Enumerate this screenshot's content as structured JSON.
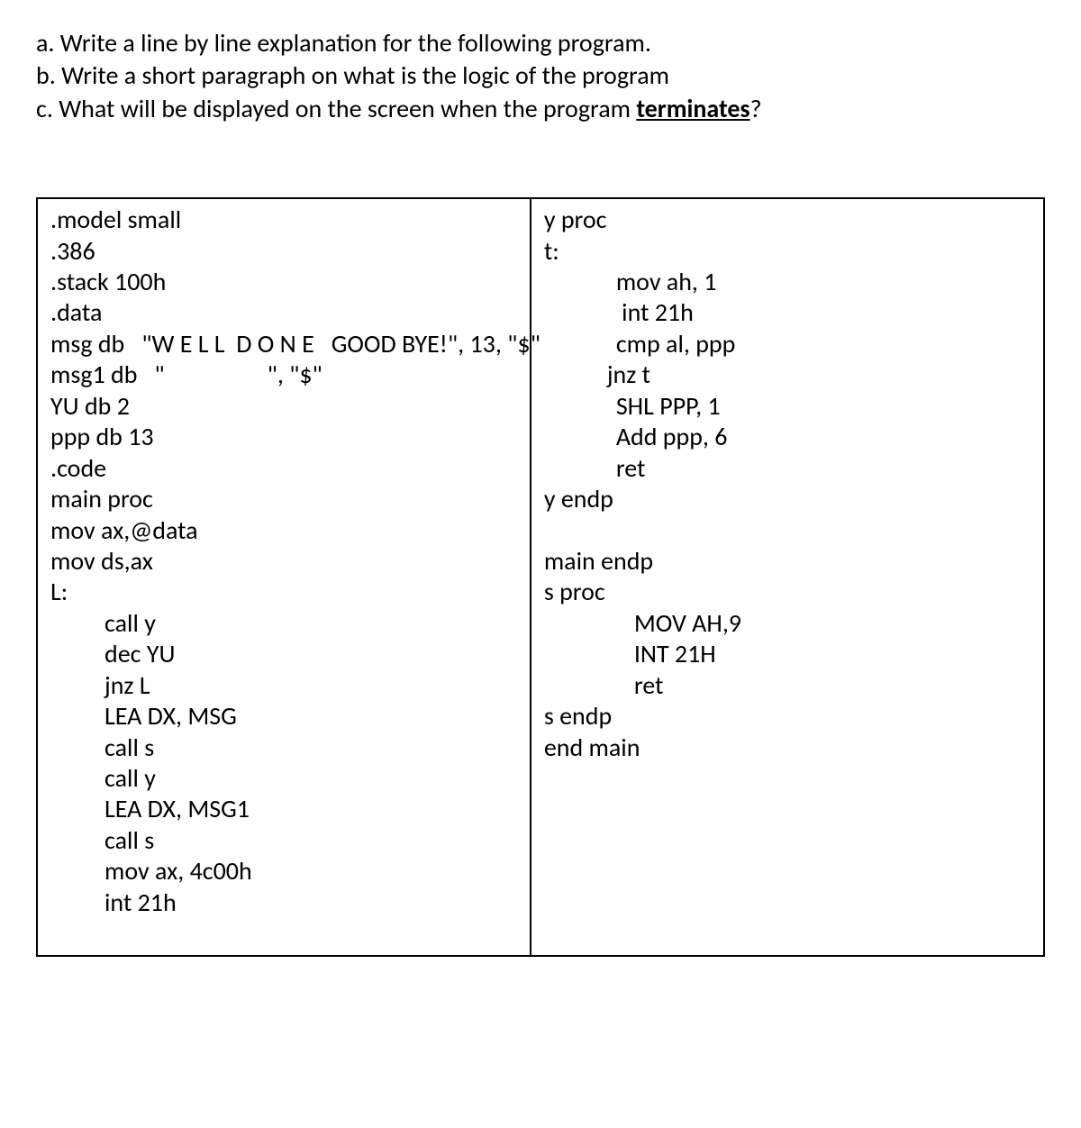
{
  "questions": {
    "a": "a. Write a line by line explanation for the following program.",
    "b": "b. Write a short paragraph on what is the logic of the program",
    "c_prefix": "c. What will be displayed on the screen when the program ",
    "c_underlined": "terminates",
    "c_suffix": "?"
  },
  "code": {
    "left": [
      {
        "text": ".model small",
        "indent": ""
      },
      {
        "text": ".386",
        "indent": ""
      },
      {
        "text": ".stack 100h",
        "indent": ""
      },
      {
        "text": ".data",
        "indent": ""
      },
      {
        "text": "msg db   \"W E L L  D O N E   GOOD BYE!\", 13, \"$\"",
        "indent": ""
      },
      {
        "text": "msg1 db   \"                  \", \"$\"",
        "indent": ""
      },
      {
        "text": "YU db 2",
        "indent": ""
      },
      {
        "text": "ppp db 13",
        "indent": ""
      },
      {
        "text": ".code",
        "indent": ""
      },
      {
        "text": "main proc",
        "indent": ""
      },
      {
        "text": "mov ax,@data",
        "indent": ""
      },
      {
        "text": "mov ds,ax",
        "indent": ""
      },
      {
        "text": "L:",
        "indent": ""
      },
      {
        "text": "call y",
        "indent": "indent1"
      },
      {
        "text": "dec YU",
        "indent": "indent1"
      },
      {
        "text": "jnz L",
        "indent": "indent1"
      },
      {
        "text": "LEA DX, MSG",
        "indent": "indent1"
      },
      {
        "text": "call s",
        "indent": "indent1"
      },
      {
        "text": "call y",
        "indent": "indent1"
      },
      {
        "text": "LEA DX, MSG1",
        "indent": "indent1"
      },
      {
        "text": "call s",
        "indent": "indent1"
      },
      {
        "text": "mov ax, 4c00h",
        "indent": "indent1"
      },
      {
        "text": "int 21h",
        "indent": "indent1"
      },
      {
        "text": " ",
        "indent": ""
      }
    ],
    "right": [
      {
        "text": "y proc",
        "indent": ""
      },
      {
        "text": "t:",
        "indent": ""
      },
      {
        "text": "mov ah, 1",
        "indent": "indent2"
      },
      {
        "text": " int 21h",
        "indent": "indent2"
      },
      {
        "text": "cmp al, ppp",
        "indent": "indent2"
      },
      {
        "text": "jnz t",
        "indent": "indent2b"
      },
      {
        "text": "SHL PPP, 1",
        "indent": "indent2"
      },
      {
        "text": "Add ppp, 6",
        "indent": "indent2"
      },
      {
        "text": "ret",
        "indent": "indent2"
      },
      {
        "text": "y endp",
        "indent": ""
      },
      {
        "text": " ",
        "indent": ""
      },
      {
        "text": "main endp",
        "indent": ""
      },
      {
        "text": "s proc",
        "indent": ""
      },
      {
        "text": "MOV AH,9",
        "indent": "indent3"
      },
      {
        "text": "INT 21H",
        "indent": "indent3"
      },
      {
        "text": "ret",
        "indent": "indent3"
      },
      {
        "text": "s endp",
        "indent": ""
      },
      {
        "text": "end main",
        "indent": ""
      }
    ]
  }
}
